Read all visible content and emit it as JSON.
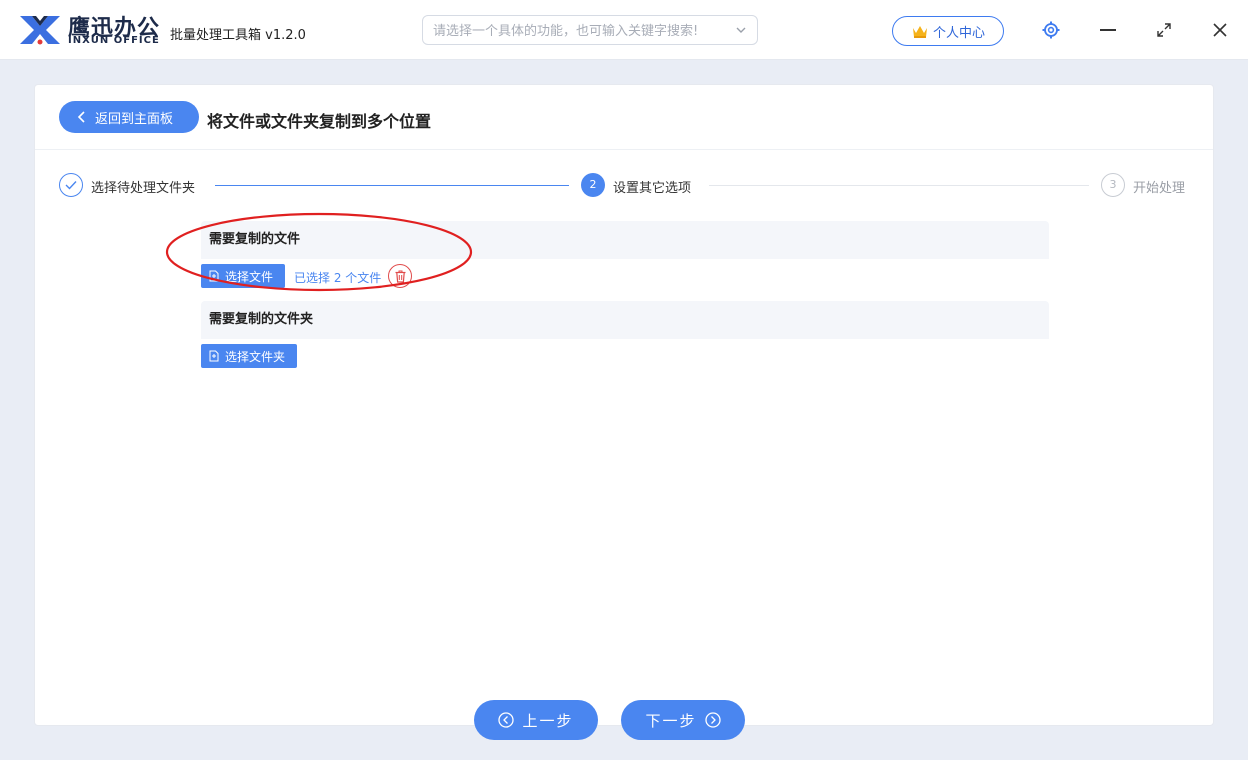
{
  "app": {
    "logo_cn": "鹰迅办公",
    "logo_en": "INXUN OFFICE",
    "title": "批量处理工具箱 v1.2.0"
  },
  "search": {
    "placeholder": "请选择一个具体的功能，也可输入关键字搜索!",
    "icon": "chevron-down-icon"
  },
  "header": {
    "user_center_label": "个人中心",
    "icons": [
      "crown-icon",
      "gear-icon",
      "minimize-icon",
      "maximize-icon",
      "close-icon"
    ]
  },
  "page": {
    "back_label": "返回到主面板",
    "title": "将文件或文件夹复制到多个位置"
  },
  "steps": [
    {
      "number": "1",
      "label": "选择待处理文件夹",
      "state": "done"
    },
    {
      "number": "2",
      "label": "设置其它选项",
      "state": "active"
    },
    {
      "number": "3",
      "label": "开始处理",
      "state": "pending"
    }
  ],
  "files_section": {
    "title": "需要复制的文件",
    "button_label": "选择文件",
    "selected_text": "已选择 2 个文件"
  },
  "folders_section": {
    "title": "需要复制的文件夹",
    "button_label": "选择文件夹"
  },
  "nav": {
    "prev_label": "上一步",
    "next_label": "下一步"
  },
  "colors": {
    "accent": "#4a86f0",
    "danger": "#e04a4a",
    "annotation": "#e02020"
  }
}
